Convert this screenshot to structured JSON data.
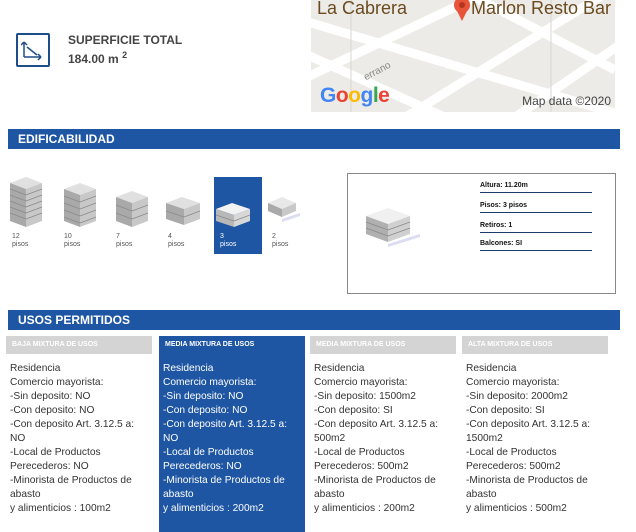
{
  "superficie": {
    "title": "SUPERFICIE TOTAL",
    "value": "184.00 m",
    "unit_sup": "2"
  },
  "map": {
    "label_1": "La Cabrera",
    "label_2": "Marlon Resto Bar",
    "street": "errano",
    "logo": [
      "G",
      "o",
      "o",
      "g",
      "l",
      "e"
    ],
    "credit": "Map data ©2020"
  },
  "edificabilidad": {
    "title": "EDIFICABILIDAD",
    "options": [
      {
        "floors": "12",
        "unit": "pisos",
        "active": false
      },
      {
        "floors": "10",
        "unit": "pisos",
        "active": false
      },
      {
        "floors": "7",
        "unit": "pisos",
        "active": false
      },
      {
        "floors": "4",
        "unit": "pisos",
        "active": false
      },
      {
        "floors": "3",
        "unit": "pisos",
        "active": true
      },
      {
        "floors": "2",
        "unit": "pisos",
        "active": false
      }
    ],
    "details": [
      "Altura: 11.20m",
      "Pisos: 3 pisos",
      "Retiros: 1",
      "Balcones: SI"
    ]
  },
  "usos": {
    "title": "USOS PERMITIDOS",
    "columns": [
      {
        "header": "BAJA MIXTURA DE USOS",
        "active": false,
        "lines": [
          "Residencia",
          "Comercio mayorista:",
          "-Sin deposito: NO",
          "-Con deposito: NO",
          "-Con deposito Art. 3.12.5 a: NO",
          "-Local de Productos Perecederos: NO",
          "-Minorista de Productos de abasto",
          "y alimenticios : 100m2"
        ]
      },
      {
        "header": "MEDIA MIXTURA DE USOS",
        "active": true,
        "lines": [
          "Residencia",
          "Comercio mayorista:",
          "-Sin deposito: NO",
          "-Con deposito: NO",
          "-Con deposito Art. 3.12.5 a: NO",
          "-Local de Productos Perecederos: NO",
          "-Minorista de Productos de abasto",
          "y alimenticios : 200m2"
        ]
      },
      {
        "header": "MEDIA MIXTURA DE USOS",
        "active": false,
        "lines": [
          "Residencia",
          "Comercio mayorista:",
          "-Sin deposito: 1500m2",
          "-Con deposito: SI",
          "-Con deposito Art. 3.12.5 a: 500m2",
          "-Local de Productos Perecederos: 500m2",
          "-Minorista de Productos de abasto",
          "y alimenticios : 200m2"
        ]
      },
      {
        "header": "ALTA MIXTURA DE USOS",
        "active": false,
        "lines": [
          "Residencia",
          "Comercio mayorista:",
          "-Sin deposito: 2000m2",
          "-Con deposito: SI",
          "-Con deposito Art. 3.12.5 a: 1500m2",
          "-Local de Productos Perecederos: 500m2",
          "-Minorista de Productos de abasto",
          "y alimenticios : 500m2"
        ]
      }
    ]
  },
  "colors": {
    "primary": "#1e56a3",
    "header_gray": "#d4d4d4"
  }
}
